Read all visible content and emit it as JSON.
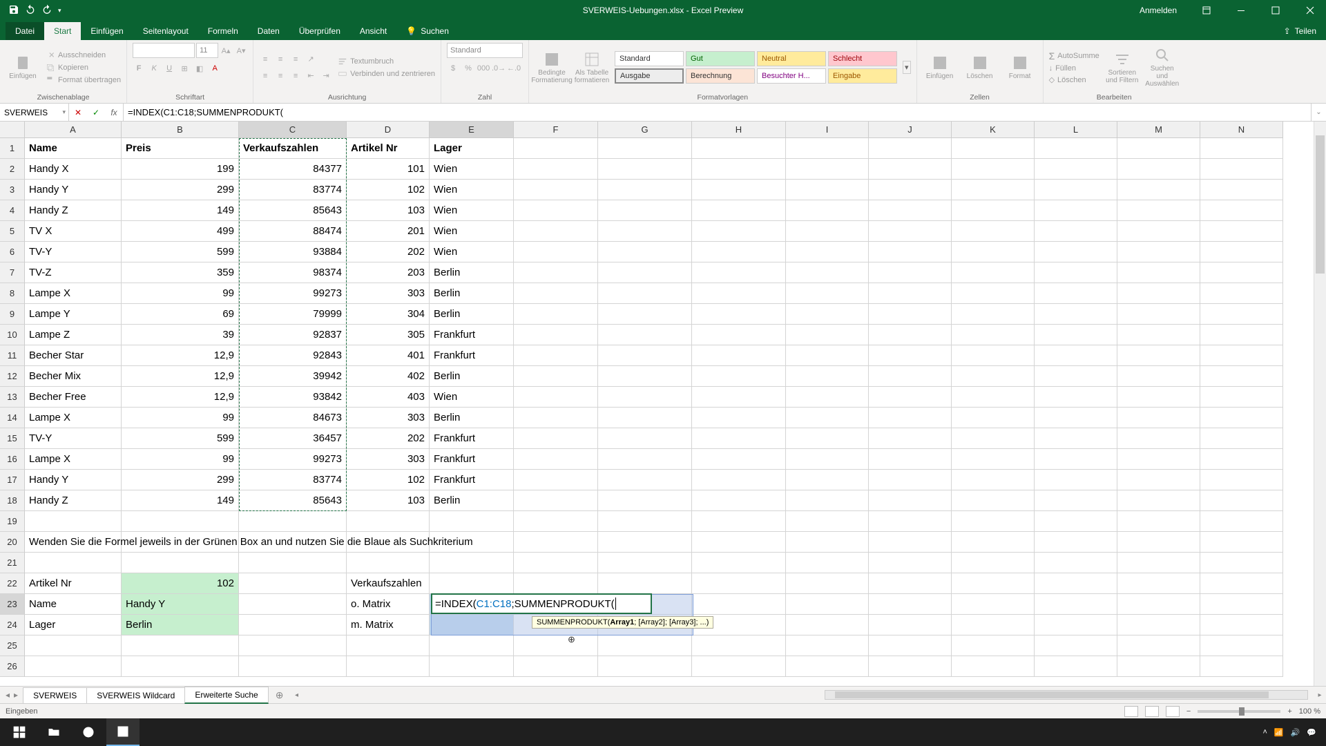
{
  "title": "SVERWEIS-Uebungen.xlsx - Excel Preview",
  "signin": "Anmelden",
  "share": "Teilen",
  "tabs": {
    "file": "Datei",
    "start": "Start",
    "insert": "Einfügen",
    "layout": "Seitenlayout",
    "formulas": "Formeln",
    "data": "Daten",
    "review": "Überprüfen",
    "view": "Ansicht",
    "search": "Suchen"
  },
  "ribbon": {
    "clipboard": {
      "label": "Zwischenablage",
      "paste": "Einfügen",
      "cut": "Ausschneiden",
      "copy": "Kopieren",
      "painter": "Format übertragen"
    },
    "font": {
      "label": "Schriftart",
      "size": "11"
    },
    "alignment": {
      "label": "Ausrichtung",
      "wrap": "Textumbruch",
      "merge": "Verbinden und zentrieren"
    },
    "number": {
      "label": "Zahl",
      "format": "Standard"
    },
    "styles": {
      "label": "Formatvorlagen",
      "cond": "Bedingte Formatierung",
      "astable": "Als Tabelle formatieren",
      "s1": "Standard",
      "s2": "Gut",
      "s3": "Neutral",
      "s4": "Schlecht",
      "s5": "Ausgabe",
      "s6": "Berechnung",
      "s7": "Besuchter H...",
      "s8": "Eingabe"
    },
    "cells": {
      "label": "Zellen",
      "insert": "Einfügen",
      "delete": "Löschen",
      "format": "Format"
    },
    "editing": {
      "label": "Bearbeiten",
      "sum": "AutoSumme",
      "fill": "Füllen",
      "clear": "Löschen",
      "sort": "Sortieren und Filtern",
      "find": "Suchen und Auswählen"
    }
  },
  "nameBox": "SVERWEIS",
  "formula": "=INDEX(C1:C18;SUMMENPRODUKT(",
  "columns": [
    "A",
    "B",
    "C",
    "D",
    "E",
    "F",
    "G",
    "H",
    "I",
    "J",
    "K",
    "L",
    "M",
    "N"
  ],
  "headers": {
    "A": "Name",
    "B": "Preis",
    "C": "Verkaufszahlen",
    "D": "Artikel Nr",
    "E": "Lager"
  },
  "rows": [
    {
      "A": "Handy X",
      "B": "199",
      "C": "84377",
      "D": "101",
      "E": "Wien"
    },
    {
      "A": "Handy Y",
      "B": "299",
      "C": "83774",
      "D": "102",
      "E": "Wien"
    },
    {
      "A": "Handy Z",
      "B": "149",
      "C": "85643",
      "D": "103",
      "E": "Wien"
    },
    {
      "A": "TV X",
      "B": "499",
      "C": "88474",
      "D": "201",
      "E": "Wien"
    },
    {
      "A": "TV-Y",
      "B": "599",
      "C": "93884",
      "D": "202",
      "E": "Wien"
    },
    {
      "A": "TV-Z",
      "B": "359",
      "C": "98374",
      "D": "203",
      "E": "Berlin"
    },
    {
      "A": "Lampe X",
      "B": "99",
      "C": "99273",
      "D": "303",
      "E": "Berlin"
    },
    {
      "A": "Lampe Y",
      "B": "69",
      "C": "79999",
      "D": "304",
      "E": "Berlin"
    },
    {
      "A": "Lampe Z",
      "B": "39",
      "C": "92837",
      "D": "305",
      "E": "Frankfurt"
    },
    {
      "A": "Becher Star",
      "B": "12,9",
      "C": "92843",
      "D": "401",
      "E": "Frankfurt"
    },
    {
      "A": "Becher Mix",
      "B": "12,9",
      "C": "39942",
      "D": "402",
      "E": "Berlin"
    },
    {
      "A": "Becher Free",
      "B": "12,9",
      "C": "93842",
      "D": "403",
      "E": "Wien"
    },
    {
      "A": "Lampe X",
      "B": "99",
      "C": "84673",
      "D": "303",
      "E": "Berlin"
    },
    {
      "A": "TV-Y",
      "B": "599",
      "C": "36457",
      "D": "202",
      "E": "Frankfurt"
    },
    {
      "A": "Lampe X",
      "B": "99",
      "C": "99273",
      "D": "303",
      "E": "Frankfurt"
    },
    {
      "A": "Handy Y",
      "B": "299",
      "C": "83774",
      "D": "102",
      "E": "Frankfurt"
    },
    {
      "A": "Handy Z",
      "B": "149",
      "C": "85643",
      "D": "103",
      "E": "Berlin"
    }
  ],
  "row20": "Wenden Sie die Formel jeweils in der Grünen Box an und nutzen Sie die Blaue als Suchkriterium",
  "lookup": {
    "A22": "Artikel Nr",
    "B22": "102",
    "D22": "Verkaufszahlen",
    "A23": "Name",
    "B23": "Handy Y",
    "D23": "o. Matrix",
    "A24": "Lager",
    "B24": "Berlin",
    "D24": "m. Matrix"
  },
  "editCell": {
    "fn1": "=INDEX(",
    "ref": "C1:C18",
    "fn2": ";SUMMENPRODUKT("
  },
  "tooltip": {
    "fn": "SUMMENPRODUKT(",
    "arg1": "Array1",
    "rest": "; [Array2]; [Array3]; ...)"
  },
  "sheets": {
    "s1": "SVERWEIS",
    "s2": "SVERWEIS Wildcard",
    "s3": "Erweiterte Suche"
  },
  "status": "Eingeben",
  "zoom": "100 %"
}
